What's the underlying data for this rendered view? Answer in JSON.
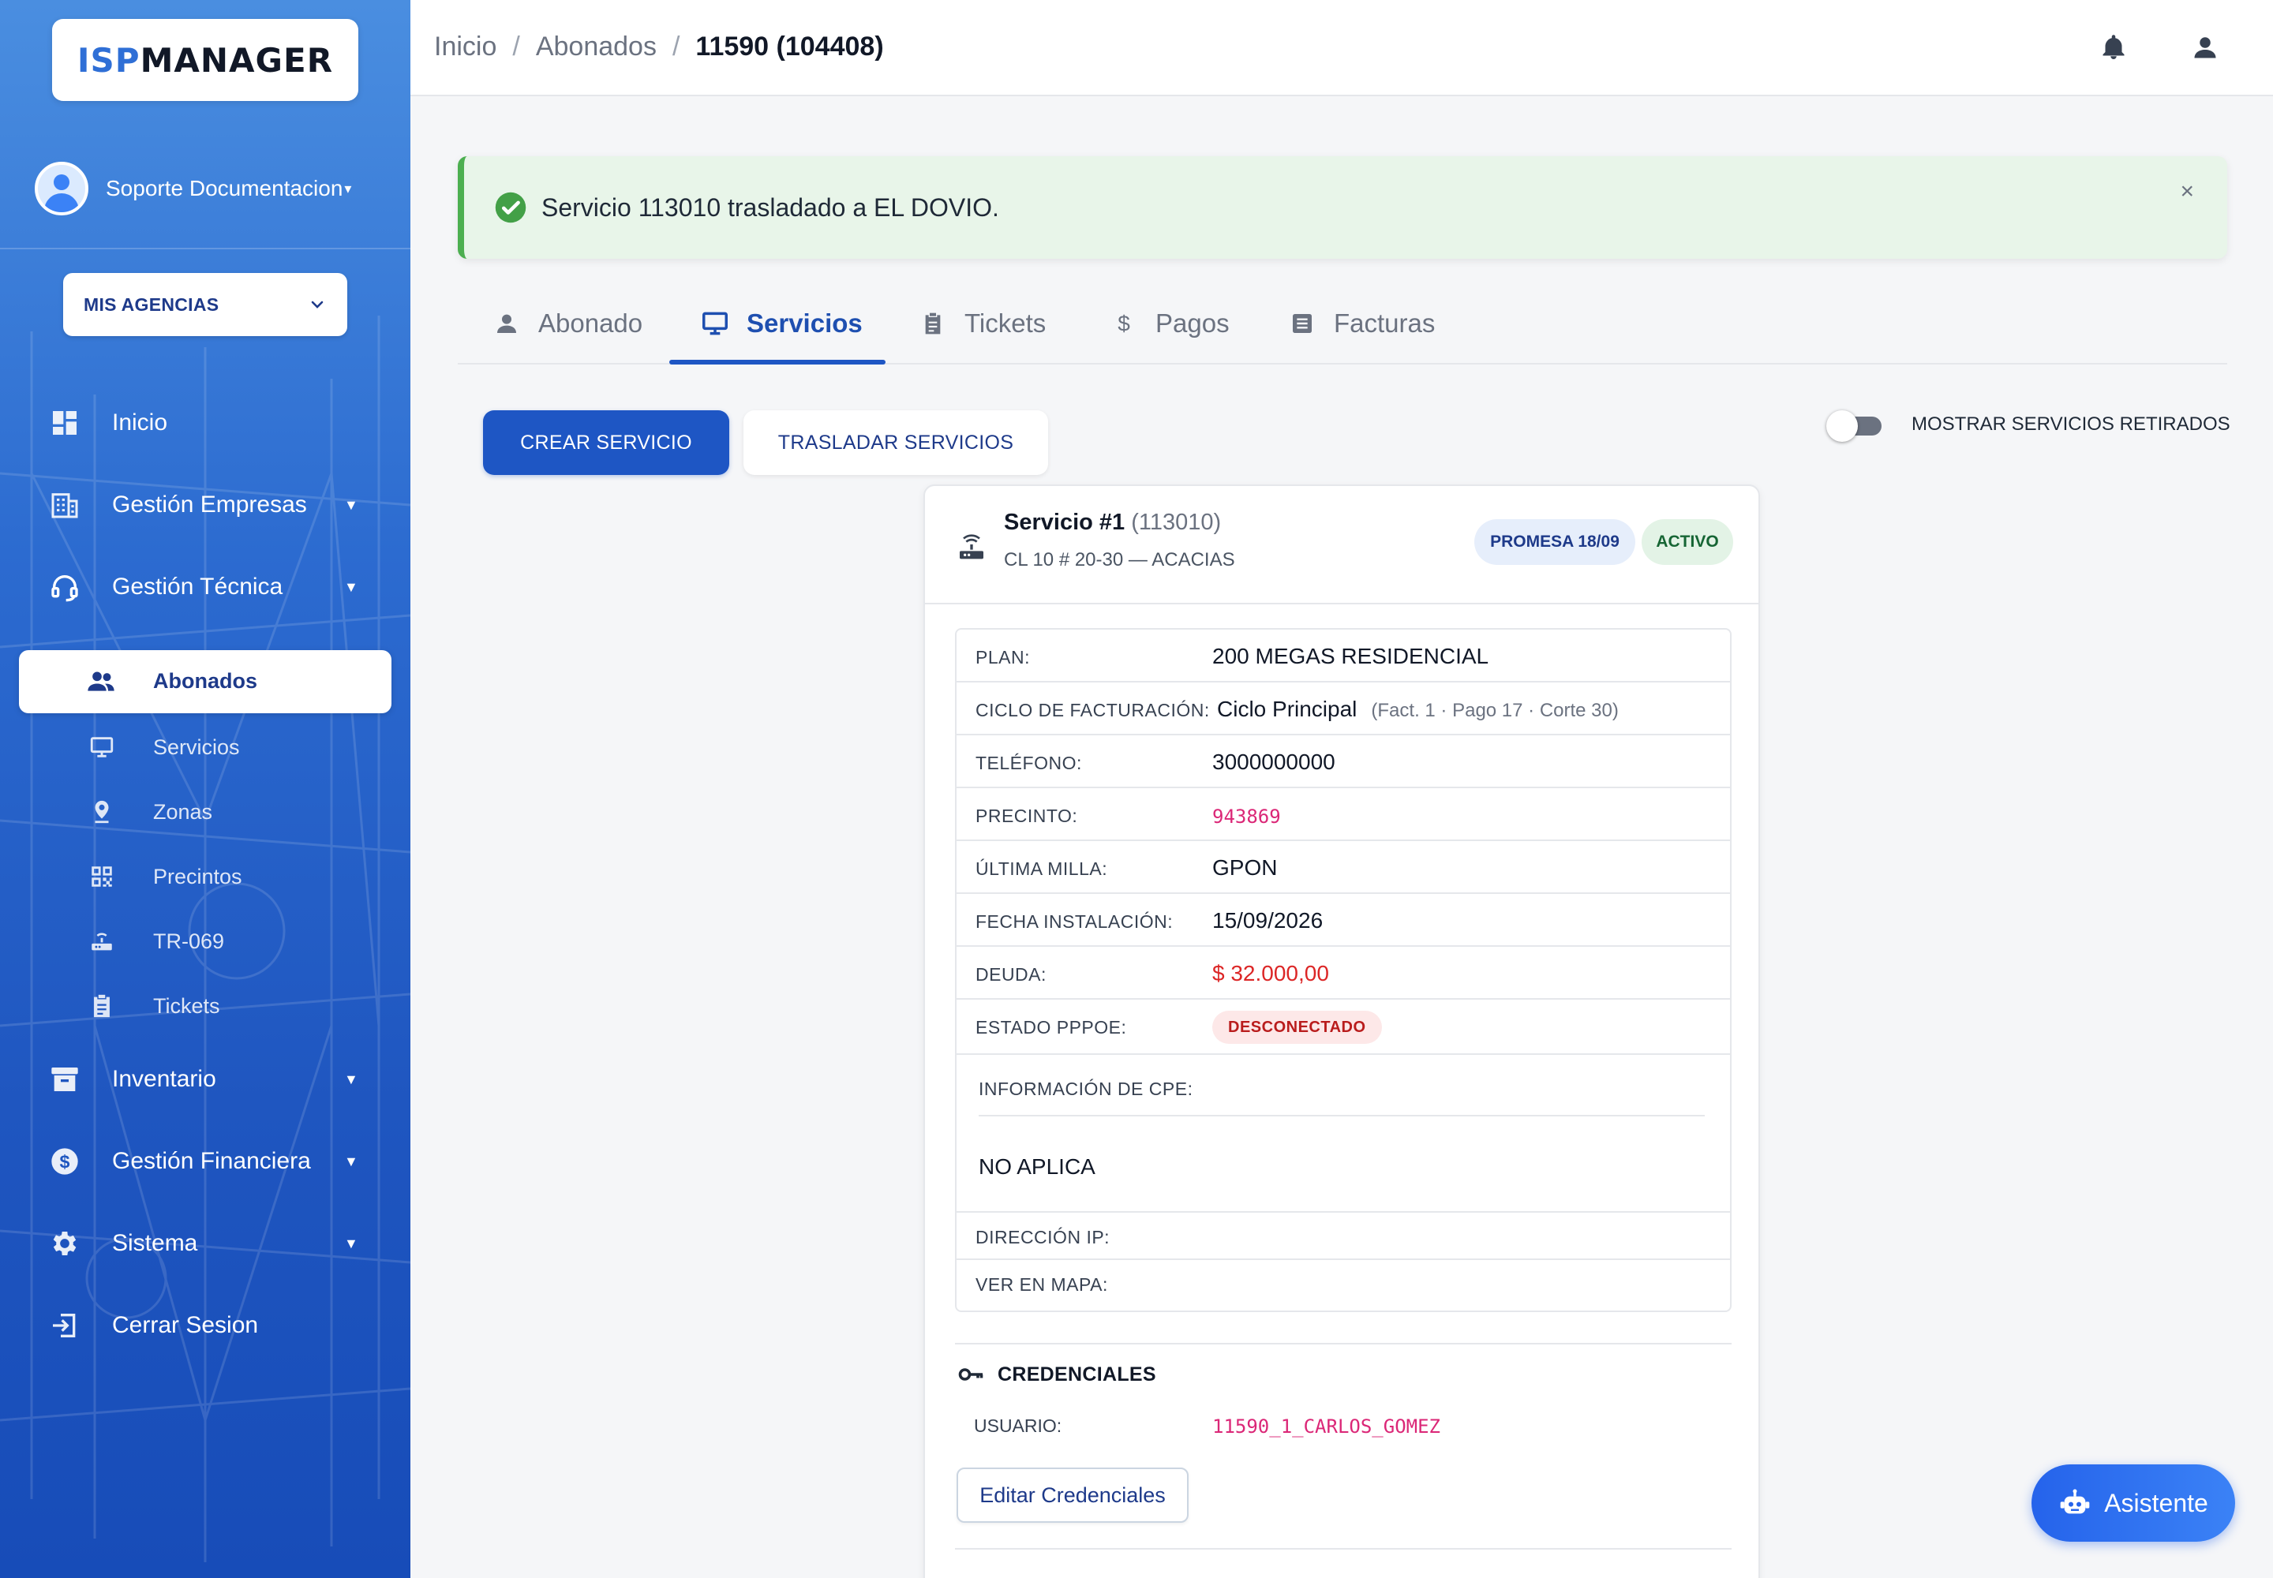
{
  "app": {
    "logo_isp": "ISP",
    "logo_manager": "MANAGER"
  },
  "sidebar": {
    "user_name": "Soporte Documentacion",
    "agency_label": "MIS AGENCIAS",
    "nav": [
      {
        "label": "Inicio",
        "icon": "dashboard-icon"
      },
      {
        "label": "Gestión Empresas",
        "icon": "building-icon"
      },
      {
        "label": "Gestión Técnica",
        "icon": "headset-icon"
      }
    ],
    "sub_active": {
      "label": "Abonados",
      "icon": "users-icon"
    },
    "sub_items": [
      {
        "label": "Servicios",
        "icon": "monitor-icon"
      },
      {
        "label": "Zonas",
        "icon": "map-pin-icon"
      },
      {
        "label": "Precintos",
        "icon": "qr-icon"
      },
      {
        "label": "TR-069",
        "icon": "router-icon"
      },
      {
        "label": "Tickets",
        "icon": "clipboard-icon"
      }
    ],
    "nav_bottom": [
      {
        "label": "Inventario",
        "icon": "archive-icon"
      },
      {
        "label": "Gestión Financiera",
        "icon": "dollar-icon"
      },
      {
        "label": "Sistema",
        "icon": "gear-icon"
      },
      {
        "label": "Cerrar Sesion",
        "icon": "logout-icon"
      }
    ]
  },
  "topbar": {
    "crumb_home": "Inicio",
    "crumb_section": "Abonados",
    "crumb_current": "11590 (104408)",
    "sep": "/"
  },
  "alert": {
    "message": "Servicio 113010 trasladado a EL DOVIO.",
    "close": "×"
  },
  "tabs": [
    {
      "label": "Abonado"
    },
    {
      "label": "Servicios"
    },
    {
      "label": "Tickets"
    },
    {
      "label": "Pagos"
    },
    {
      "label": "Facturas"
    }
  ],
  "actions": {
    "create": "CREAR SERVICIO",
    "transfer": "TRASLADAR SERVICIOS",
    "show_retired": "MOSTRAR SERVICIOS RETIRADOS",
    "show_retired_on": false
  },
  "service": {
    "title": "Servicio #1",
    "id": "(113010)",
    "address": "CL 10 # 20-30 — ACACIAS",
    "chip_promesa": "PROMESA 18/09",
    "chip_status": "ACTIVO",
    "plan_k": "PLAN:",
    "plan_v": "200 MEGAS RESIDENCIAL",
    "ciclo_k": "CICLO DE FACTURACIÓN:",
    "ciclo_v": "Ciclo Principal",
    "ciclo_detail": "(Fact. 1 · Pago 17 · Corte 30)",
    "tel_k": "TELÉFONO:",
    "tel_v": "3000000000",
    "precinto_k": "PRECINTO:",
    "precinto_v": "943869",
    "milla_k": "ÚLTIMA MILLA:",
    "milla_v": "GPON",
    "fecha_k": "FECHA INSTALACIÓN:",
    "fecha_v": "15/09/2026",
    "deuda_k": "DEUDA:",
    "deuda_v": "$ 32.000,00",
    "pppoe_k": "ESTADO PPPOE:",
    "pppoe_v": "DESCONECTADO",
    "cpe_k": "INFORMACIÓN DE CPE:",
    "cpe_v": "NO APLICA",
    "ip_k": "DIRECCIÓN IP:",
    "mapa_k": "VER EN MAPA:",
    "cred_title": "CREDENCIALES",
    "user_k": "USUARIO:",
    "user_v": "11590_1_CARLOS_GOMEZ",
    "edit_cred": "Editar Credenciales"
  },
  "fab": {
    "label": "Asistente"
  },
  "colors": {
    "primary": "#1e56c4",
    "success": "#4caf50",
    "danger": "#dc2626",
    "pink": "#db2777"
  }
}
